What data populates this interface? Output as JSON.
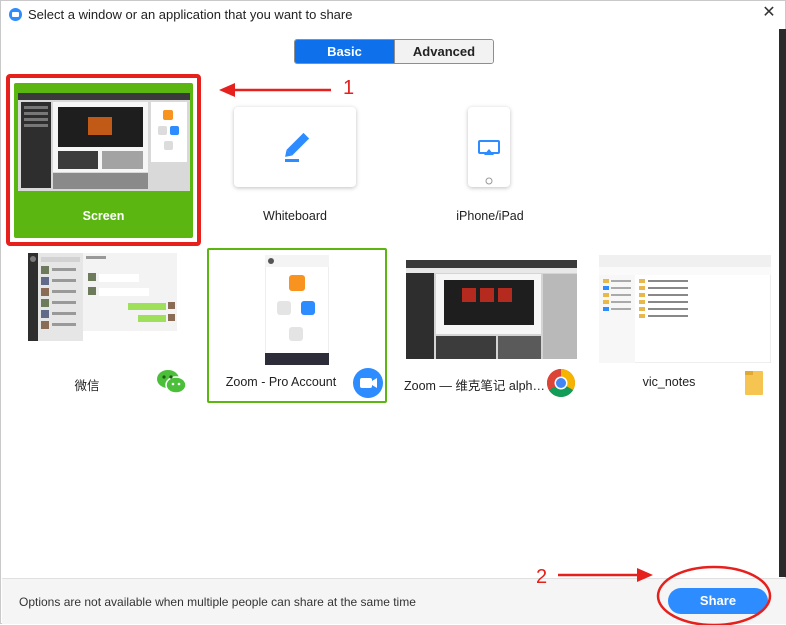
{
  "window": {
    "title": "Select a window or an application that you want to share",
    "close_glyph": "✕"
  },
  "tabs": [
    {
      "label": "Basic",
      "active": true
    },
    {
      "label": "Advanced",
      "active": false
    }
  ],
  "tiles": {
    "screen": {
      "label": "Screen",
      "selected_color": "#5bb612"
    },
    "whiteboard": {
      "label": "Whiteboard",
      "icon": "pen-icon"
    },
    "iphone": {
      "label": "iPhone/iPad",
      "icon": "airplay-icon"
    },
    "wechat": {
      "label": "微信",
      "icon": "wechat-icon"
    },
    "zoom": {
      "label": "Zoom - Pro Account",
      "icon": "zoom-icon"
    },
    "chrome": {
      "label": "Zoom — 维克笔记 alph…",
      "icon": "chrome-icon"
    },
    "explorer": {
      "label": "vic_notes",
      "icon": "folder-icon"
    }
  },
  "bottom": {
    "notice": "Options are not available when multiple people can share at the same time",
    "share_label": "Share"
  },
  "annotations": {
    "one": "1",
    "two": "2",
    "color": "#e6201c"
  },
  "colors": {
    "accent": "#0e71eb",
    "share": "#2d8cff",
    "selected": "#5bb612"
  }
}
